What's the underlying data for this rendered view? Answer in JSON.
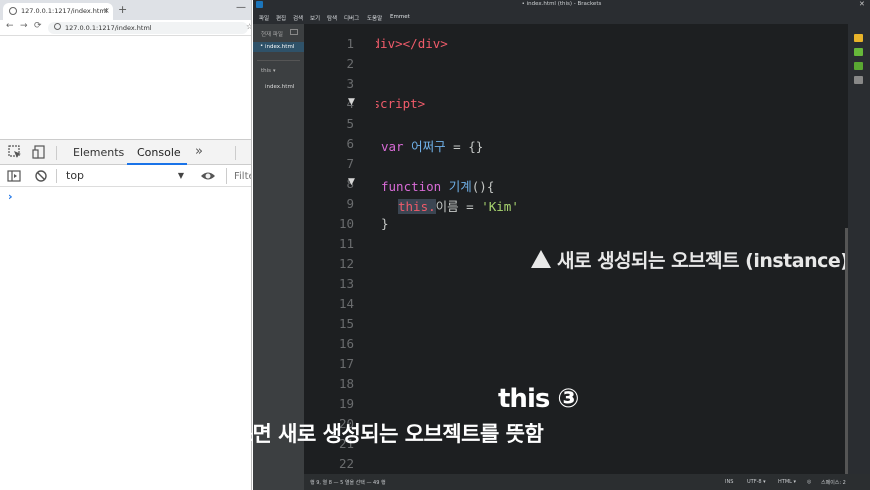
{
  "chrome": {
    "tab_title": "127.0.0.1:1217/index.html",
    "tab_close": "×",
    "new_tab": "+",
    "window_minimize": "—",
    "url": "127.0.0.1:1217/index.html",
    "devtools": {
      "tabs": [
        "Elements",
        "Console"
      ],
      "active_tab": "Console",
      "more": "»",
      "context": "top",
      "filter_placeholder": "Filte",
      "prompt": "›"
    }
  },
  "brackets": {
    "window_title": "• index.html (this) - Brackets",
    "menu": [
      "파일",
      "편집",
      "검색",
      "보기",
      "탐색",
      "디버그",
      "도움말",
      "Emmet"
    ],
    "sidebar": {
      "working_files_label": "현재 파일",
      "active_file": "index.html",
      "project_name": "this",
      "project_files": [
        "index.html"
      ]
    },
    "line_numbers": [
      "1",
      "2",
      "3",
      "4",
      "5",
      "6",
      "7",
      "8",
      "9",
      "10",
      "11",
      "12",
      "13",
      "14",
      "15",
      "16",
      "17",
      "18",
      "19",
      "20",
      "21",
      "22"
    ],
    "code": {
      "l1_open": "<div>",
      "l1_close": "</div>",
      "l4_tag": "<script>",
      "l6_kw": "var",
      "l6_name": "어쩌구",
      "l6_rest": " = {}",
      "l8_kw": "function",
      "l8_name": "기계",
      "l8_rest": "(){",
      "l9_this": "this.",
      "l9_prop": "이름",
      "l9_eq": " = ",
      "l9_str": "'Kim'",
      "l10": "}"
    },
    "annotation": "새로 생성되는 오브젝트 (instance)",
    "status": {
      "position": "행 9, 열 8 — 5 열을 선택 — 49 행",
      "mode": "INS",
      "encoding": "UTF-8 ▾",
      "language": "HTML ▾",
      "spaces": "스페이스: 2"
    }
  },
  "subtitle": {
    "title": "this ③",
    "body": "기계 안에서 쓰면 새로 생성되는 오브젝트를 뜻함"
  }
}
